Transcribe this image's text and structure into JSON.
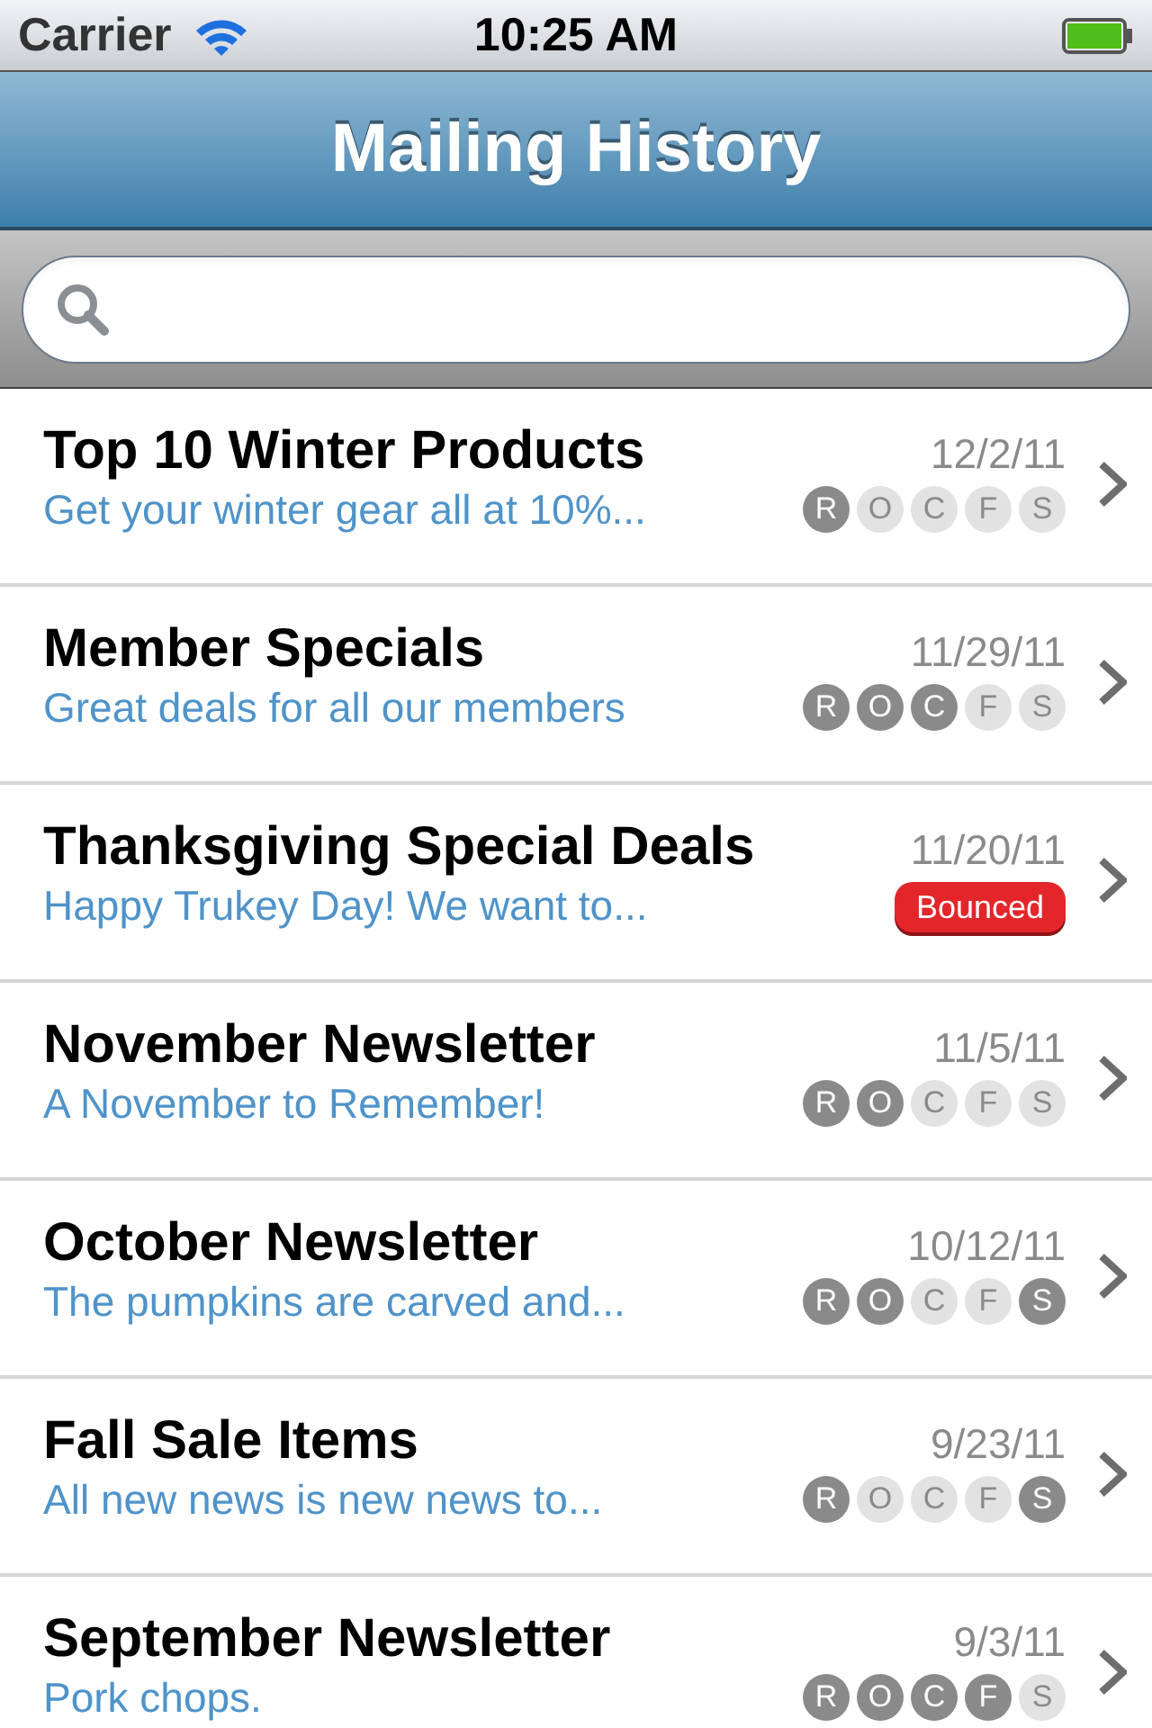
{
  "status_bar": {
    "carrier": "Carrier",
    "time": "10:25 AM"
  },
  "nav_bar": {
    "title": "Mailing History"
  },
  "mailings": [
    {
      "title": "Top 10 Winter Products",
      "subtitle": "Get your winter gear all at 10%...",
      "date": "12/2/11",
      "kind": "stats",
      "stats": [
        {
          "letter": "R",
          "on": true
        },
        {
          "letter": "O",
          "on": false
        },
        {
          "letter": "C",
          "on": false
        },
        {
          "letter": "F",
          "on": false
        },
        {
          "letter": "S",
          "on": false
        }
      ]
    },
    {
      "title": "Member Specials",
      "subtitle": "Great deals for all our members",
      "date": "11/29/11",
      "kind": "stats",
      "stats": [
        {
          "letter": "R",
          "on": true
        },
        {
          "letter": "O",
          "on": true
        },
        {
          "letter": "C",
          "on": true
        },
        {
          "letter": "F",
          "on": false
        },
        {
          "letter": "S",
          "on": false
        }
      ]
    },
    {
      "title": "Thanksgiving Special Deals",
      "subtitle": "Happy Trukey Day! We want to...",
      "date": "11/20/11",
      "kind": "bounced",
      "badge": "Bounced"
    },
    {
      "title": "November Newsletter",
      "subtitle": "A November to Remember!",
      "date": "11/5/11",
      "kind": "stats",
      "stats": [
        {
          "letter": "R",
          "on": true
        },
        {
          "letter": "O",
          "on": true
        },
        {
          "letter": "C",
          "on": false
        },
        {
          "letter": "F",
          "on": false
        },
        {
          "letter": "S",
          "on": false
        }
      ]
    },
    {
      "title": "October Newsletter",
      "subtitle": "The pumpkins are carved and...",
      "date": "10/12/11",
      "kind": "stats",
      "stats": [
        {
          "letter": "R",
          "on": true
        },
        {
          "letter": "O",
          "on": true
        },
        {
          "letter": "C",
          "on": false
        },
        {
          "letter": "F",
          "on": false
        },
        {
          "letter": "S",
          "on": true
        }
      ]
    },
    {
      "title": "Fall Sale Items",
      "subtitle": "All new news is new news to...",
      "date": "9/23/11",
      "kind": "stats",
      "stats": [
        {
          "letter": "R",
          "on": true
        },
        {
          "letter": "O",
          "on": false
        },
        {
          "letter": "C",
          "on": false
        },
        {
          "letter": "F",
          "on": false
        },
        {
          "letter": "S",
          "on": true
        }
      ]
    },
    {
      "title": "September Newsletter",
      "subtitle": "Pork chops.",
      "date": "9/3/11",
      "kind": "stats",
      "stats": [
        {
          "letter": "R",
          "on": true
        },
        {
          "letter": "O",
          "on": true
        },
        {
          "letter": "C",
          "on": true
        },
        {
          "letter": "F",
          "on": true
        },
        {
          "letter": "S",
          "on": false
        }
      ]
    }
  ]
}
